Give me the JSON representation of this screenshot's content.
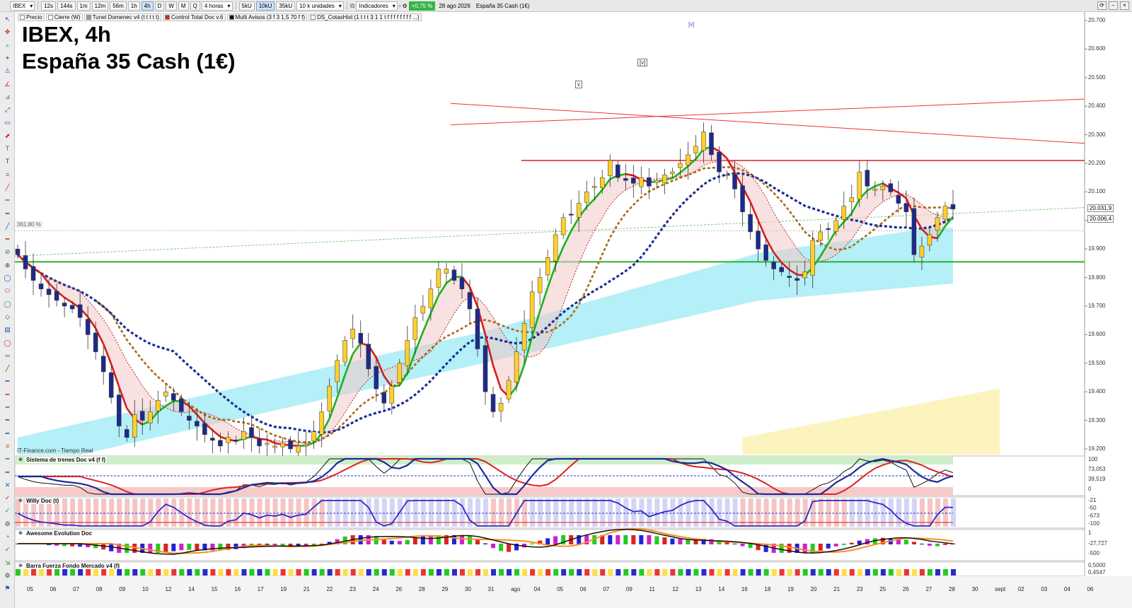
{
  "toolbar": {
    "symbol": "IBEX",
    "timeframes": [
      "12s",
      "144s",
      "1m",
      "12m",
      "56m",
      "1h",
      "4h",
      "D",
      "W",
      "M",
      "Q"
    ],
    "active_timeframe": "4h",
    "period_select": "4 horas",
    "volume_buttons": [
      "5kU",
      "10kU",
      "35kU"
    ],
    "active_volume": "10kU",
    "units_select": "10 k unidades",
    "indicators_button": "Indicadores",
    "change": "+0,75 %",
    "date": "28 ago 2026",
    "instrument": "España 35 Cash (1€)"
  },
  "legend": [
    {
      "label": "Precio",
      "color": "#ffffff"
    },
    {
      "label": "Cierre (W)",
      "color": "#ffffff"
    },
    {
      "label": "Tunel Domenec v4 (t t t t t)",
      "color": "#9a9a9a"
    },
    {
      "label": "Control Total Doc v.6",
      "color": "#d22"
    },
    {
      "label": "Multi Avisos (3 f 3 1,5 70 f f)",
      "color": "#111"
    },
    {
      "label": "DS_CotasHist (1 t t t 3 1 1 t f f f f f f f f ...)",
      "color": "#ffffff"
    }
  ],
  "chart": {
    "title": "IBEX, 4h",
    "subtitle": "España 35 Cash (1€)",
    "source": "IT-Finance.com - Tiempo Real",
    "pct_label": "361,80 %",
    "price_ticks": [
      "20.700",
      "20.600",
      "20.500",
      "20.400",
      "20.300",
      "20.200",
      "20.100",
      "20.000",
      "19.900",
      "19.800",
      "19.700",
      "19.600",
      "19.500",
      "19.400",
      "19.300",
      "19.200"
    ],
    "price_boxes": [
      "20.031,9",
      "20.006,4"
    ],
    "x_ticks": [
      "05",
      "06",
      "07",
      "08",
      "09",
      "10",
      "12",
      "14",
      "15",
      "16",
      "17",
      "19",
      "21",
      "22",
      "23",
      "24",
      "26",
      "28",
      "29",
      "30",
      "31",
      "ago",
      "04",
      "05",
      "06",
      "07",
      "09",
      "11",
      "12",
      "13",
      "14",
      "16",
      "18",
      "19",
      "20",
      "21",
      "23",
      "25",
      "26",
      "27",
      "28",
      "30",
      "sept",
      "02",
      "03",
      "04",
      "06"
    ],
    "waves": [
      "v",
      "[v]",
      "[v]"
    ]
  },
  "panes": [
    {
      "title": "Sistema de trenes Doc v4 (f f)",
      "ticks": [
        "100",
        "73,053",
        "39,519",
        "0"
      ]
    },
    {
      "title": "Willy Doc (t)",
      "ticks": [
        "-21",
        "-50",
        "-673",
        "-100"
      ]
    },
    {
      "title": "Awesome Evolution Doc",
      "ticks": [
        "1",
        "-27,727",
        "-500"
      ]
    },
    {
      "title": "Barra Fuerza Fondo Mercado v4 (f)",
      "ticks": [
        "0,5000",
        "0,4547"
      ]
    }
  ],
  "chart_data": {
    "type": "candlestick",
    "ylim": [
      19180,
      20720
    ],
    "closes": [
      19880,
      19830,
      19790,
      19760,
      19740,
      19720,
      19700,
      19690,
      19660,
      19600,
      19540,
      19470,
      19380,
      19280,
      19240,
      19320,
      19300,
      19330,
      19370,
      19400,
      19370,
      19330,
      19300,
      19280,
      19250,
      19230,
      19210,
      19240,
      19230,
      19260,
      19240,
      19210,
      19220,
      19210,
      19220,
      19200,
      19210,
      19215,
      19260,
      19330,
      19420,
      19510,
      19580,
      19620,
      19570,
      19480,
      19410,
      19360,
      19420,
      19500,
      19580,
      19660,
      19700,
      19760,
      19830,
      19830,
      19790,
      19760,
      19690,
      19550,
      19400,
      19330,
      19360,
      19440,
      19540,
      19640,
      19750,
      19800,
      19870,
      19950,
      20010,
      20020,
      20060,
      20100,
      20120,
      20150,
      20210,
      20150,
      20140,
      20130,
      20150,
      20120,
      20140,
      20160,
      20170,
      20200,
      20230,
      20260,
      20310,
      20230,
      20170,
      20160,
      20110,
      20030,
      19960,
      19900,
      19860,
      19830,
      19820,
      19800,
      19790,
      19820,
      19930,
      19960,
      19970,
      20000,
      20050,
      20080,
      20170,
      20120,
      20110,
      20120,
      20100,
      20060,
      20030,
      19880,
      19910,
      19950,
      20010,
      20050,
      20040
    ],
    "levels": {
      "green_support": 19855,
      "red_resistance": 20210
    },
    "trendlines": [
      {
        "from": [
          19900,
          20420
        ],
        "to": [
          20270,
          20300
        ]
      },
      {
        "from": [
          20330,
          20340
        ],
        "to": [
          20400,
          20300
        ]
      }
    ]
  }
}
